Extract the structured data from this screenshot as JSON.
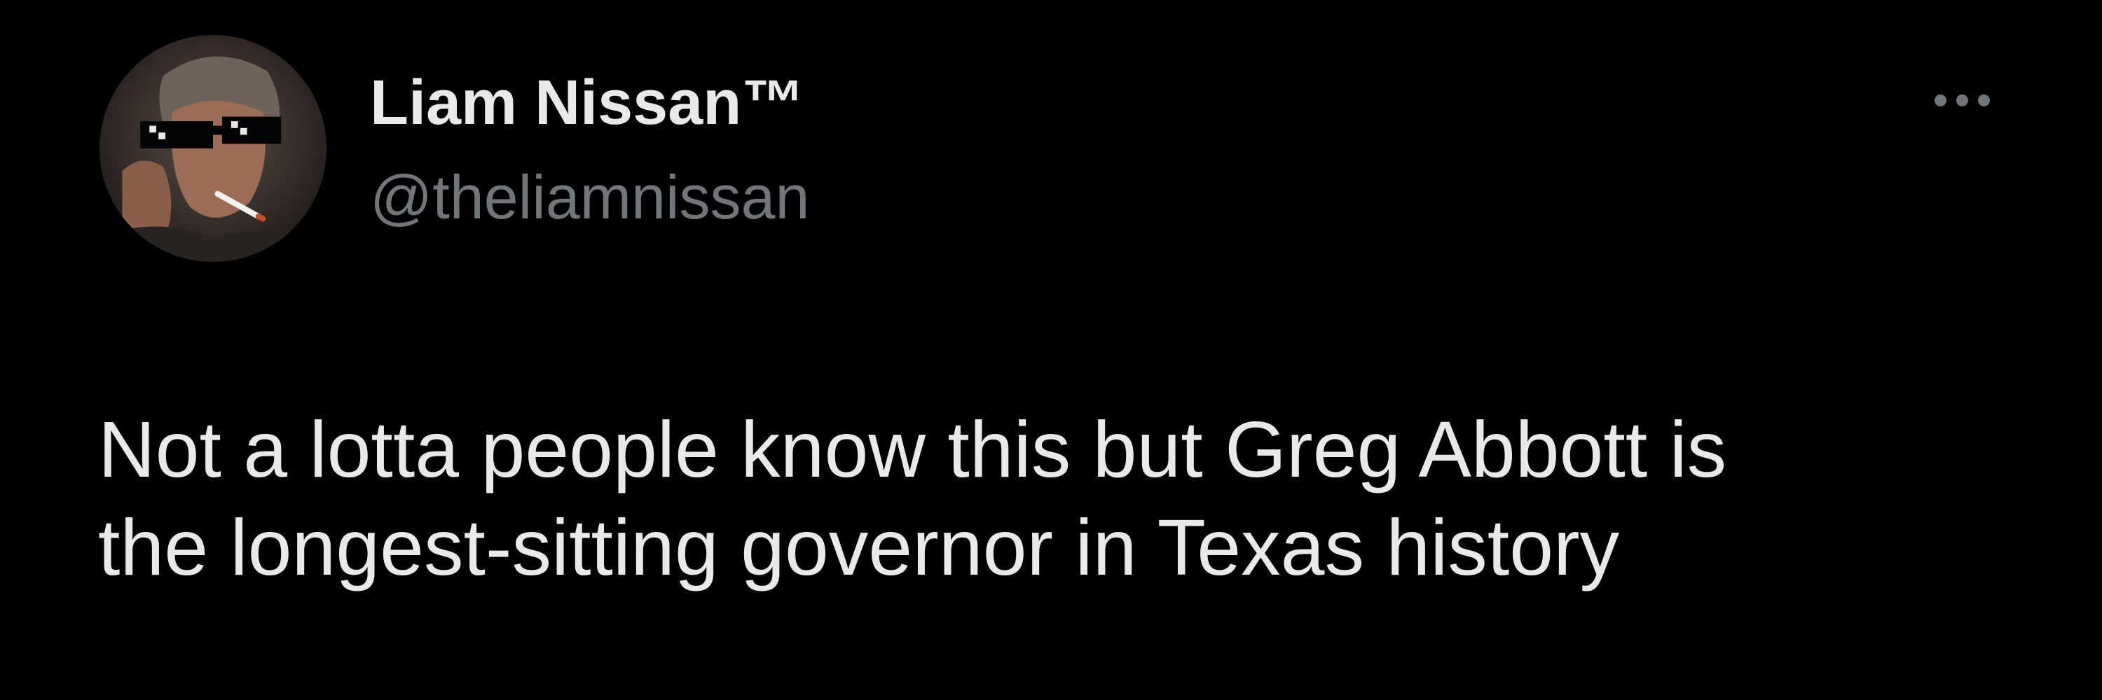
{
  "tweet": {
    "author": {
      "display_name": "Liam Nissan™",
      "handle": "@theliamnissan"
    },
    "text": "Not a lotta people know this but Greg Abbott is\nthe longest-sitting governor in Texas history",
    "more_icon": "more-horizontal-icon"
  },
  "colors": {
    "background": "#000000",
    "text_primary": "#e7e9ea",
    "text_secondary": "#71767b"
  }
}
